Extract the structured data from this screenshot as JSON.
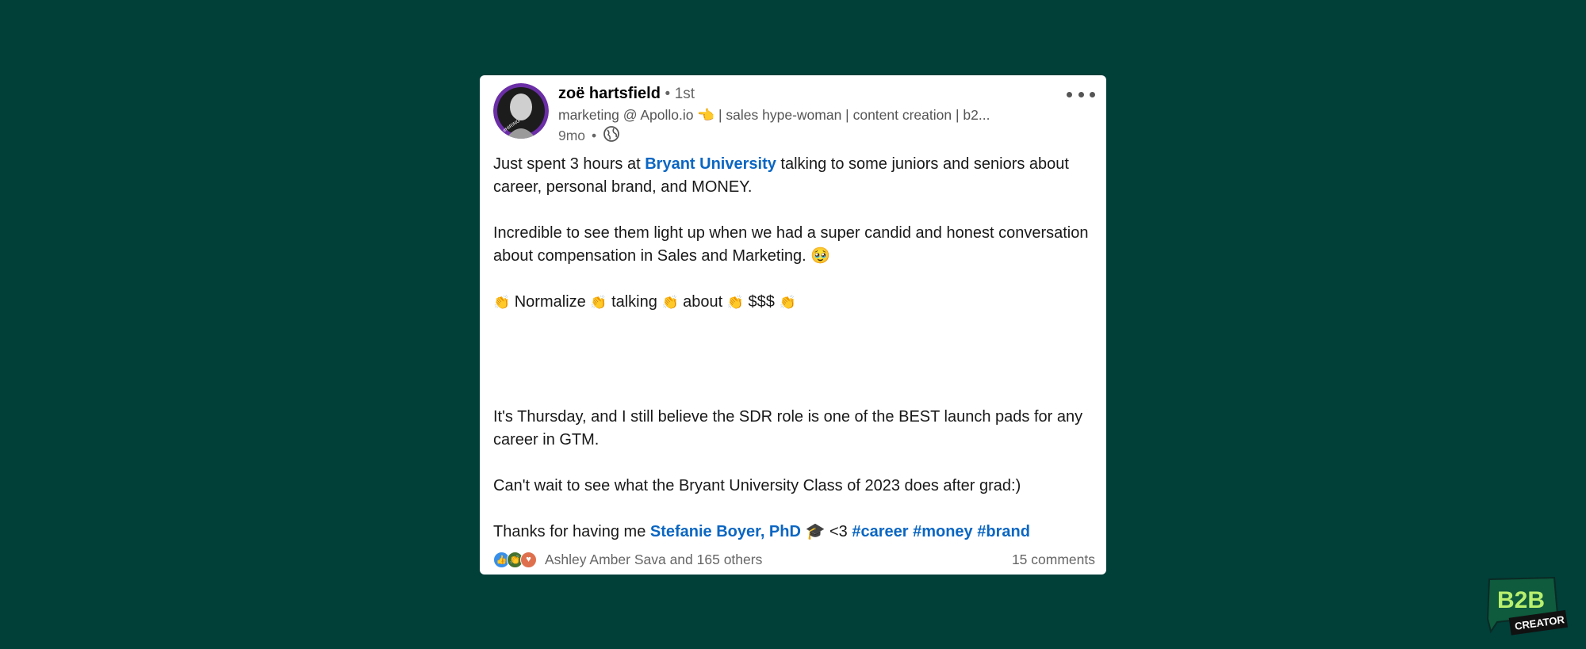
{
  "post": {
    "author": {
      "name": "zoë hartsfield",
      "separator": "•",
      "degree": "1st"
    },
    "headline": "marketing @ Apollo.io 👈 | sales hype-woman | content creation | b2...",
    "time": "9mo",
    "time_separator": "•",
    "avatar_badge": "#HIRING",
    "p1": {
      "a": "Just spent 3 hours at ",
      "mention": "Bryant University",
      "b": " talking to some juniors and seniors about career, personal brand, and MONEY."
    },
    "p2": "Incredible to see them light up when we had a super candid and honest conversation about compensation in Sales and Marketing. 🥹",
    "p3": {
      "words": [
        "Normalize",
        "talking",
        "about",
        "$$$"
      ],
      "emoji": "👏"
    },
    "p4": "It's Thursday, and I still believe the SDR role is one of the BEST launch pads for any career in GTM.",
    "p5": "Can't wait to see what the Bryant University Class of 2023 does after grad:)",
    "p6": {
      "a": "Thanks for having me ",
      "mention": "Stefanie Boyer, PhD",
      "emoji": "🎓",
      "b": " <3 ",
      "tags": [
        "#career",
        "#money",
        "#brand"
      ]
    },
    "reactions_text": "Ashley Amber Sava and 165 others",
    "comments": "15 comments"
  },
  "brand": {
    "line1": "B2B",
    "line2": "CREATOR"
  },
  "colors": {
    "background": "#013f39",
    "card": "#ffffff",
    "link": "#0a66c2",
    "avatar": "#6b2ea6",
    "logo": "#b8f06e"
  }
}
